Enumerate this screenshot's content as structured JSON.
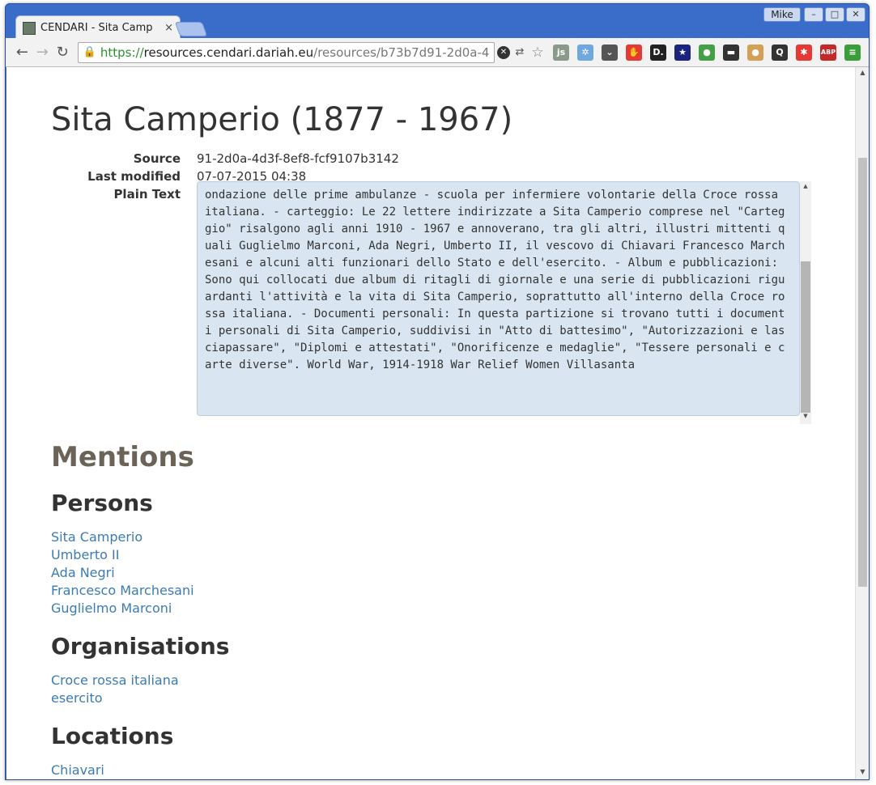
{
  "browser": {
    "tab_title": "CENDARI - Sita Camp",
    "tab_close": "×",
    "profile_name": "Mike",
    "url_scheme": "https://",
    "url_host": "resources.cendari.dariah.eu",
    "url_path": "/resources/b73b7d91-2d0a-4",
    "extensions": [
      {
        "name": "js-icon",
        "label": "js",
        "color": "#8a9a8a"
      },
      {
        "name": "snowflake-icon",
        "label": "✲",
        "color": "#6fa8dc"
      },
      {
        "name": "pocket-icon",
        "label": "⌄",
        "color": "#555555"
      },
      {
        "name": "hand-stop-icon",
        "label": "✋",
        "color": "#e53935"
      },
      {
        "name": "d-logo-icon",
        "label": "D.",
        "color": "#222222"
      },
      {
        "name": "night-sky-icon",
        "label": "★",
        "color": "#1a237e"
      },
      {
        "name": "leaf-icon",
        "label": "●",
        "color": "#43a047"
      },
      {
        "name": "spy-mask-icon",
        "label": "▬",
        "color": "#333333"
      },
      {
        "name": "cookie-icon",
        "label": "●",
        "color": "#d4a056"
      },
      {
        "name": "magnifier-q-icon",
        "label": "Q",
        "color": "#333333"
      },
      {
        "name": "red-star-badge-icon",
        "label": "✱",
        "color": "#e53935"
      },
      {
        "name": "abp-icon",
        "label": "ABP",
        "color": "#c62828"
      },
      {
        "name": "menu-icon",
        "label": "≡",
        "color": "#3a9d3a"
      }
    ]
  },
  "page": {
    "title": "Sita Camperio (1877 - 1967)",
    "meta": [
      {
        "label": "Source",
        "value": "91-2d0a-4d3f-8ef8-fcf9107b3142"
      },
      {
        "label": "Last modified",
        "value": "07-07-2015 04:38"
      },
      {
        "label": "Plain Text",
        "value": ""
      }
    ],
    "plain_text": "ondazione delle prime ambulanze - scuola per infermiere volontarie della Croce rossa italiana. - carteggio: Le 22 lettere indirizzate a Sita Camperio comprese nel \"Carteggio\" risalgono agli anni 1910 - 1967 e annoverano, tra gli altri, illustri mittenti quali Guglielmo Marconi, Ada Negri, Umberto II, il vescovo di Chiavari Francesco Marchesani e alcuni alti funzionari dello Stato e dell'esercito. - Album e pubblicazioni: Sono qui collocati due album di ritagli di giornale e una serie di pubblicazioni riguardanti l'attività e la vita di Sita Camperio, soprattutto all'interno della Croce rossa italiana. - Documenti personali: In questa partizione si trovano tutti i documenti personali di Sita Camperio, suddivisi in \"Atto di battesimo\", \"Autorizzazioni e lasciapassare\", \"Diplomi e attestati\", \"Onorificenze e medaglie\", \"Tessere personali e carte diverse\". World War, 1914-1918 War Relief Women Villasanta",
    "mentions_heading": "Mentions",
    "persons_heading": "Persons",
    "persons": [
      "Sita Camperio",
      "Umberto II",
      "Ada Negri",
      "Francesco Marchesani",
      "Guglielmo Marconi"
    ],
    "organisations_heading": "Organisations",
    "organisations": [
      "Croce rossa italiana",
      "esercito"
    ],
    "locations_heading": "Locations",
    "locations": [
      "Chiavari"
    ]
  }
}
